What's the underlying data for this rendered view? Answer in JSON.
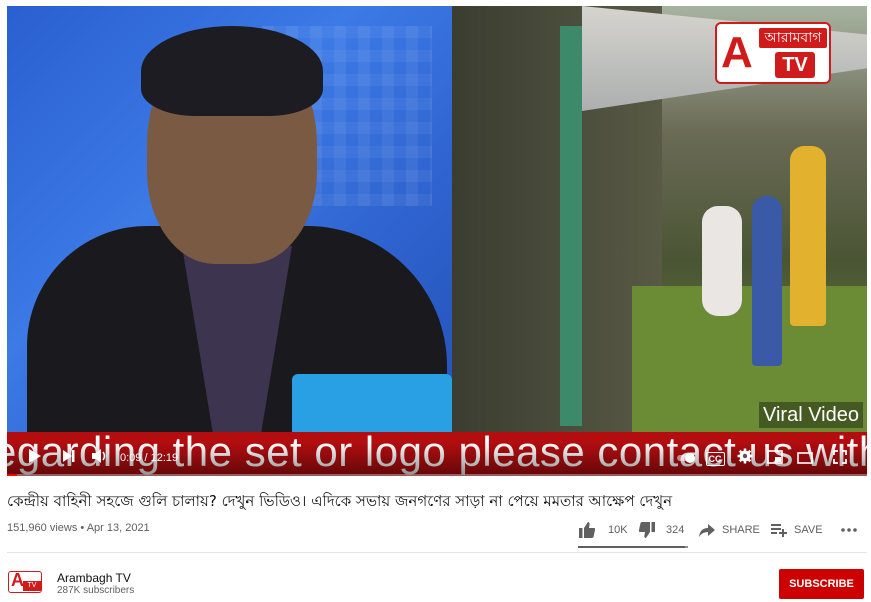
{
  "player": {
    "ticker_text": "egarding the set or logo please contact us with le",
    "watermark_logo": {
      "letter": "A",
      "name": "আরামবাগ",
      "tv": "TV"
    },
    "overlay_label": "Viral Video",
    "time_current": "0:09",
    "time_separator": " / ",
    "time_total": "12:19",
    "progress_fraction": 0.012,
    "controls": {
      "play": "play-icon",
      "next": "skip-next-icon",
      "volume": "volume-icon",
      "autoplay": "autoplay-toggle-icon",
      "captions": "CC",
      "settings": "gear-icon",
      "miniplayer": "miniplayer-icon",
      "theater": "theater-mode-icon",
      "fullscreen": "fullscreen-icon"
    }
  },
  "video": {
    "title": "কেন্দ্রীয় বাহিনী সহজে গুলি চালায়? দেখুন ভিডিও। এদিকে সভায় জনগণের সাড়া না পেয়ে মমতার আক্ষেপ দেখুন",
    "views": "151,960 views",
    "date_separator": " • ",
    "date": "Apr 13, 2021",
    "likes": "10K",
    "dislikes": "324",
    "like_ratio": 0.969,
    "share_label": "SHARE",
    "save_label": "SAVE",
    "more_icon": "more-horizontal-icon"
  },
  "channel": {
    "name": "Arambagh TV",
    "subscribers": "287K subscribers",
    "avatar_letter": "A",
    "avatar_tv": "TV",
    "subscribe_label": "SUBSCRIBE"
  },
  "colors": {
    "brand_red": "#d11b1b",
    "ticker_red": "#b30d10",
    "subscribe_red": "#cc0000",
    "progress_red": "#ff0000"
  }
}
